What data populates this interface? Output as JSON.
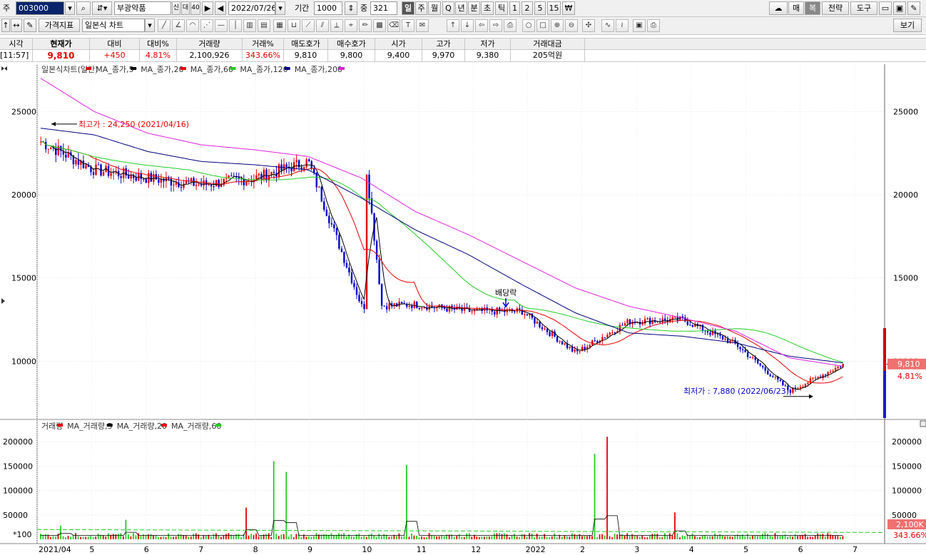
{
  "toolbar": {
    "code_label": "주",
    "stock_code": "003000",
    "stock_name": "부광약품",
    "badge_1": "신",
    "badge_2": "대",
    "badge_3": "40",
    "date": "2022/07/26",
    "period_label": "기간",
    "period_value": "1000",
    "middle_label": "중",
    "middle_value": "321",
    "periods": [
      "일",
      "주",
      "월",
      "Q",
      "년",
      "분",
      "초",
      "틱",
      "1",
      "2",
      "5",
      "15",
      "₩"
    ],
    "right_buttons": [
      "매",
      "복",
      "전략",
      "도구"
    ],
    "indicator_label": "가격지표",
    "chart_type": "일본식 차트",
    "view_label": "보기"
  },
  "quote": {
    "headers": [
      "시각",
      "현재가",
      "대비",
      "대비%",
      "거래량",
      "거래%",
      "매도호가",
      "매수호가",
      "시가",
      "고가",
      "저가",
      "거래대금"
    ],
    "values": [
      "[11:57]",
      "9,810",
      "+450",
      "4.81%",
      "2,100,926",
      "343.66%",
      "9,810",
      "9,800",
      "9,400",
      "9,970",
      "9,380",
      "205억원"
    ]
  },
  "chart": {
    "price_legend": [
      {
        "text": "일본식차트(일간)",
        "color": "#e60000"
      },
      {
        "text": "MA_종가,5",
        "color": "#000000"
      },
      {
        "text": "MA_종가,20",
        "color": "#e60000"
      },
      {
        "text": "MA_종가,60",
        "color": "#22cc22"
      },
      {
        "text": "MA_종가,120",
        "color": "#000080"
      },
      {
        "text": "MA_종가,200",
        "color": "#e020e0"
      }
    ],
    "volume_legend": [
      {
        "text": "거래량",
        "color": "#e60000"
      },
      {
        "text": "MA_거래량,5",
        "color": "#000000"
      },
      {
        "text": "MA_거래량,20",
        "color": "#e60000"
      },
      {
        "text": "MA_거래량,60",
        "color": "#22cc22"
      }
    ],
    "high_annotation": "최고가 : 24,250 (2021/04/16)",
    "low_annotation": "최저가 : 7,880 (2022/06/23)",
    "dividend_label": "배당락",
    "price_badge": "9,810",
    "percent_badge": "4.81%",
    "volume_badge": "2,100K",
    "volume_percent": "343.66%",
    "volume_unit": "*100",
    "price_ticks": [
      "25000",
      "20000",
      "15000",
      "10000"
    ],
    "volume_ticks": [
      "200000",
      "150000",
      "100000",
      "50000"
    ],
    "x_labels": [
      "2021/04",
      "5",
      "6",
      "7",
      "8",
      "9",
      "10",
      "11",
      "12",
      "2022",
      "2",
      "3",
      "4",
      "5",
      "6",
      "7"
    ]
  },
  "chart_data": {
    "type": "candlestick",
    "x": [
      "2021/04",
      "2021/05",
      "2021/06",
      "2021/07",
      "2021/08",
      "2021/09",
      "2021/10",
      "2021/11",
      "2021/12",
      "2022/01",
      "2022/02",
      "2022/03",
      "2022/04",
      "2022/05",
      "2022/06",
      "2022/07"
    ],
    "price_anchor_close": [
      23200,
      21500,
      21000,
      20600,
      21000,
      22000,
      13300,
      13400,
      13000,
      13000,
      10500,
      12400,
      12500,
      11000,
      8200,
      9810
    ],
    "ma200_approx": [
      27000,
      25000,
      23700,
      23000,
      22700,
      22300,
      21000,
      19000,
      17600,
      16000,
      14400,
      13300,
      12600,
      11800,
      10200,
      9700
    ],
    "ma120_approx": [
      24000,
      23600,
      22600,
      22000,
      21800,
      21500,
      19800,
      17900,
      16400,
      14600,
      12900,
      11700,
      11500,
      11100,
      10300,
      9900
    ],
    "ylim": [
      6500,
      27500
    ],
    "volume_ylim": [
      0,
      225000
    ],
    "volume_spikes": [
      {
        "date": "2021/04",
        "value": 28000
      },
      {
        "date": "2021/05",
        "value": 40000
      },
      {
        "date": "2021/07",
        "value": 65000
      },
      {
        "date": "2021/08",
        "value": 160000
      },
      {
        "date": "2021/08",
        "value": 138000
      },
      {
        "date": "2021/10",
        "value": 152000
      },
      {
        "date": "2022/02",
        "value": 175000
      },
      {
        "date": "2022/02",
        "value": 210000
      },
      {
        "date": "2022/03",
        "value": 55000
      },
      {
        "date": "2022/07",
        "value": 78000
      },
      {
        "date": "2022/07",
        "value": 68000
      }
    ]
  },
  "colors": {
    "up": "#e60000",
    "down": "#0000cc",
    "accent": "#0a246a"
  }
}
